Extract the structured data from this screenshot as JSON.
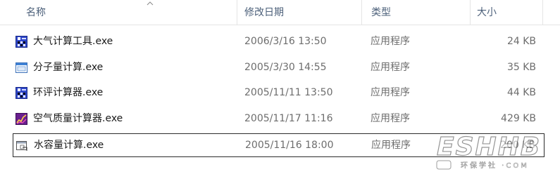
{
  "columns": {
    "name": "名称",
    "modified": "修改日期",
    "type": "类型",
    "size": "大小"
  },
  "files": [
    {
      "name": "大气计算工具.exe",
      "modified": "2006/3/16 13:50",
      "type": "应用程序",
      "size": "24 KB",
      "icon": "calculator-app-icon"
    },
    {
      "name": "分子量计算.exe",
      "modified": "2005/3/30 14:55",
      "type": "应用程序",
      "size": "35 KB",
      "icon": "window-app-icon"
    },
    {
      "name": "环评计算器.exe",
      "modified": "2005/11/11 13:50",
      "type": "应用程序",
      "size": "44 KB",
      "icon": "calculator-app-icon"
    },
    {
      "name": "空气质量计算器.exe",
      "modified": "2005/11/17 11:16",
      "type": "应用程序",
      "size": "429 KB",
      "icon": "chart-app-icon"
    },
    {
      "name": "水容量计算.exe",
      "modified": "2005/11/16 18:00",
      "type": "应用程序",
      "size": "200 KB",
      "icon": "generic-exe-icon"
    }
  ],
  "watermark": {
    "logo": "ESHHB",
    "text": "环保学社 ·COM"
  },
  "colors": {
    "header_text": "#4c607a",
    "secondary_text": "#6d6d6d"
  }
}
